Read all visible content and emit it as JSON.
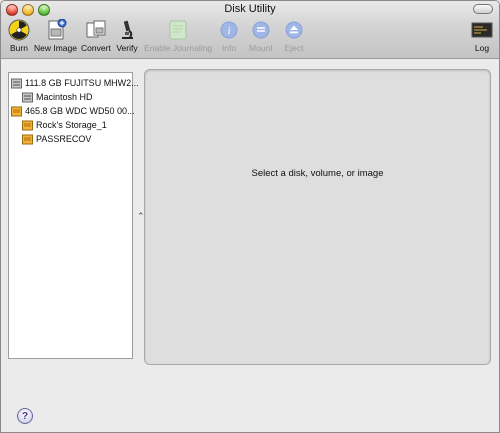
{
  "window": {
    "title": "Disk Utility"
  },
  "toolbar": {
    "items": [
      {
        "label": "Burn",
        "icon": "burn-icon",
        "enabled": true
      },
      {
        "label": "New Image",
        "icon": "new-image-icon",
        "enabled": true
      },
      {
        "label": "Convert",
        "icon": "convert-icon",
        "enabled": true
      },
      {
        "label": "Verify",
        "icon": "verify-icon",
        "enabled": true
      },
      {
        "label": "Enable Journaling",
        "icon": "enable-journaling-icon",
        "enabled": false
      },
      {
        "label": "Info",
        "icon": "info-icon",
        "enabled": false
      },
      {
        "label": "Mount",
        "icon": "mount-icon",
        "enabled": false
      },
      {
        "label": "Eject",
        "icon": "eject-icon",
        "enabled": false
      },
      {
        "label": "Log",
        "icon": "log-icon",
        "enabled": true
      }
    ]
  },
  "sidebar": {
    "items": [
      {
        "label": "111.8 GB FUJITSU MHW2...",
        "type": "internal-disk"
      },
      {
        "label": "Macintosh HD",
        "type": "volume"
      },
      {
        "label": "465.8 GB WDC WD50 00...",
        "type": "external-disk"
      },
      {
        "label": "Rock's Storage_1",
        "type": "external-volume"
      },
      {
        "label": "PASSRECOV",
        "type": "external-volume"
      }
    ]
  },
  "main": {
    "message": "Select a disk, volume, or image"
  },
  "colors": {
    "toolbar_top": "#e9e9e9",
    "toolbar_bottom": "#c4c4c4",
    "content_bg": "#dedede",
    "disabled_text": "#9a9a9a"
  }
}
